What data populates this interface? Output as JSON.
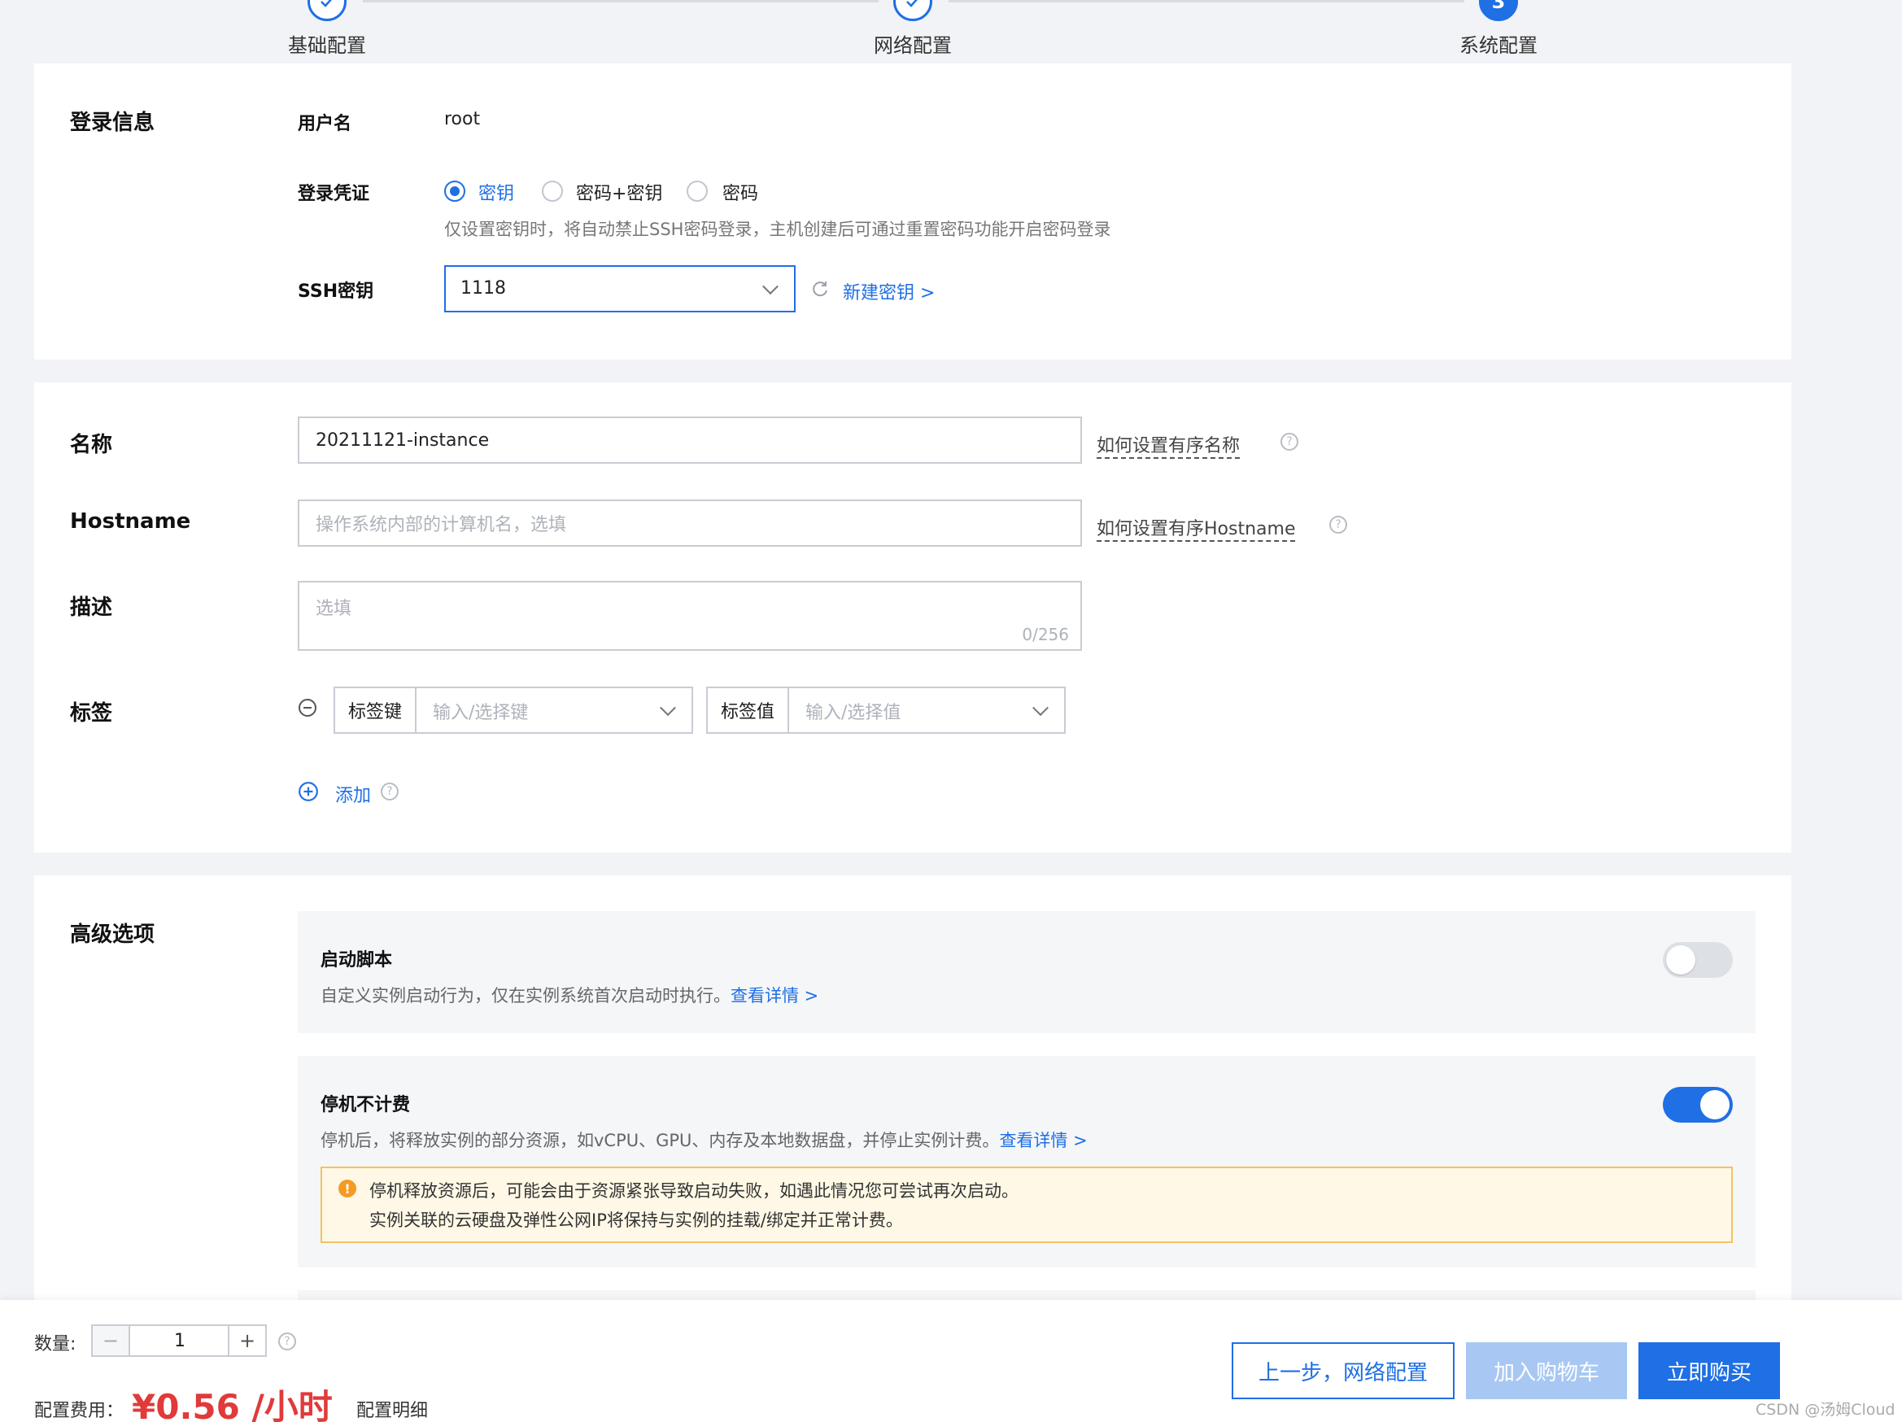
{
  "steps": [
    {
      "label": "基础配置",
      "state": "done"
    },
    {
      "label": "网络配置",
      "state": "done"
    },
    {
      "label": "系统配置",
      "state": "active",
      "number": "3"
    }
  ],
  "login": {
    "section_title": "登录信息",
    "username_label": "用户名",
    "username_value": "root",
    "credential_label": "登录凭证",
    "credential_options": [
      "密钥",
      "密码+密钥",
      "密码"
    ],
    "credential_selected": "密钥",
    "credential_hint": "仅设置密钥时，将自动禁止SSH密码登录，主机创建后可通过重置密码功能开启密码登录",
    "ssh_label": "SSH密钥",
    "ssh_value": "1118",
    "new_key_link": "新建密钥 >"
  },
  "basic": {
    "name_label": "名称",
    "name_value": "20211121-instance",
    "name_help": "如何设置有序名称",
    "hostname_label": "Hostname",
    "hostname_placeholder": "操作系统内部的计算机名，选填",
    "hostname_help": "如何设置有序Hostname",
    "desc_label": "描述",
    "desc_placeholder": "选填",
    "desc_counter": "0/256",
    "tag_label": "标签",
    "tag_key_label": "标签键",
    "tag_key_placeholder": "输入/选择键",
    "tag_value_label": "标签值",
    "tag_value_placeholder": "输入/选择值",
    "add_label": "添加"
  },
  "advanced": {
    "section_title": "高级选项",
    "startup": {
      "title": "启动脚本",
      "desc": "自定义实例启动行为，仅在实例系统首次启动时执行。",
      "link": "查看详情 >",
      "enabled": false
    },
    "no_charge": {
      "title": "停机不计费",
      "desc": "停机后，将释放实例的部分资源，如vCPU、GPU、内存及本地数据盘，并停止实例计费。",
      "link": "查看详情 >",
      "enabled": true,
      "warning_line1": "停机释放资源后，可能会由于资源紧张导致启动失败，如遇此情况您可尝试再次启动。",
      "warning_line2": "实例关联的云硬盘及弹性公网IP将保持与实例的挂载/绑定并正常计费。"
    }
  },
  "footer": {
    "quantity_label": "数量:",
    "quantity_value": "1",
    "minus": "−",
    "plus": "+",
    "fee_label": "配置费用：",
    "fee_value": "¥0.56 /小时",
    "fee_detail": "配置明细",
    "prev_button": "上一步，网络配置",
    "cart_button": "加入购物车",
    "buy_button": "立即购买",
    "watermark": "CSDN @汤姆Cloud"
  },
  "colors": {
    "primary": "#1f6fe5",
    "price": "#e03a3a",
    "warning_bg": "#fff8e6"
  }
}
